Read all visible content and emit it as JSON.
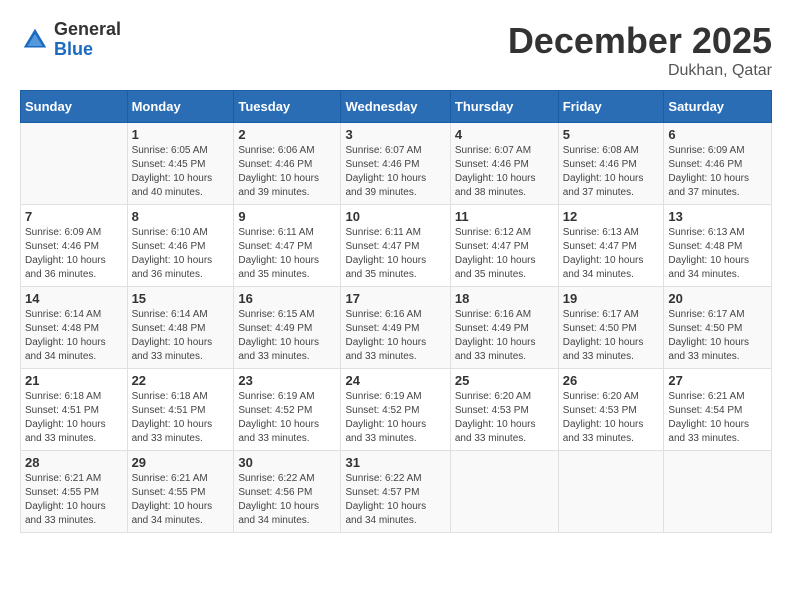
{
  "header": {
    "logo": {
      "general": "General",
      "blue": "Blue"
    },
    "title": "December 2025",
    "location": "Dukhan, Qatar"
  },
  "columns": [
    "Sunday",
    "Monday",
    "Tuesday",
    "Wednesday",
    "Thursday",
    "Friday",
    "Saturday"
  ],
  "weeks": [
    [
      {
        "day": "",
        "info": ""
      },
      {
        "day": "1",
        "info": "Sunrise: 6:05 AM\nSunset: 4:45 PM\nDaylight: 10 hours\nand 40 minutes."
      },
      {
        "day": "2",
        "info": "Sunrise: 6:06 AM\nSunset: 4:46 PM\nDaylight: 10 hours\nand 39 minutes."
      },
      {
        "day": "3",
        "info": "Sunrise: 6:07 AM\nSunset: 4:46 PM\nDaylight: 10 hours\nand 39 minutes."
      },
      {
        "day": "4",
        "info": "Sunrise: 6:07 AM\nSunset: 4:46 PM\nDaylight: 10 hours\nand 38 minutes."
      },
      {
        "day": "5",
        "info": "Sunrise: 6:08 AM\nSunset: 4:46 PM\nDaylight: 10 hours\nand 37 minutes."
      },
      {
        "day": "6",
        "info": "Sunrise: 6:09 AM\nSunset: 4:46 PM\nDaylight: 10 hours\nand 37 minutes."
      }
    ],
    [
      {
        "day": "7",
        "info": "Sunrise: 6:09 AM\nSunset: 4:46 PM\nDaylight: 10 hours\nand 36 minutes."
      },
      {
        "day": "8",
        "info": "Sunrise: 6:10 AM\nSunset: 4:46 PM\nDaylight: 10 hours\nand 36 minutes."
      },
      {
        "day": "9",
        "info": "Sunrise: 6:11 AM\nSunset: 4:47 PM\nDaylight: 10 hours\nand 35 minutes."
      },
      {
        "day": "10",
        "info": "Sunrise: 6:11 AM\nSunset: 4:47 PM\nDaylight: 10 hours\nand 35 minutes."
      },
      {
        "day": "11",
        "info": "Sunrise: 6:12 AM\nSunset: 4:47 PM\nDaylight: 10 hours\nand 35 minutes."
      },
      {
        "day": "12",
        "info": "Sunrise: 6:13 AM\nSunset: 4:47 PM\nDaylight: 10 hours\nand 34 minutes."
      },
      {
        "day": "13",
        "info": "Sunrise: 6:13 AM\nSunset: 4:48 PM\nDaylight: 10 hours\nand 34 minutes."
      }
    ],
    [
      {
        "day": "14",
        "info": "Sunrise: 6:14 AM\nSunset: 4:48 PM\nDaylight: 10 hours\nand 34 minutes."
      },
      {
        "day": "15",
        "info": "Sunrise: 6:14 AM\nSunset: 4:48 PM\nDaylight: 10 hours\nand 33 minutes."
      },
      {
        "day": "16",
        "info": "Sunrise: 6:15 AM\nSunset: 4:49 PM\nDaylight: 10 hours\nand 33 minutes."
      },
      {
        "day": "17",
        "info": "Sunrise: 6:16 AM\nSunset: 4:49 PM\nDaylight: 10 hours\nand 33 minutes."
      },
      {
        "day": "18",
        "info": "Sunrise: 6:16 AM\nSunset: 4:49 PM\nDaylight: 10 hours\nand 33 minutes."
      },
      {
        "day": "19",
        "info": "Sunrise: 6:17 AM\nSunset: 4:50 PM\nDaylight: 10 hours\nand 33 minutes."
      },
      {
        "day": "20",
        "info": "Sunrise: 6:17 AM\nSunset: 4:50 PM\nDaylight: 10 hours\nand 33 minutes."
      }
    ],
    [
      {
        "day": "21",
        "info": "Sunrise: 6:18 AM\nSunset: 4:51 PM\nDaylight: 10 hours\nand 33 minutes."
      },
      {
        "day": "22",
        "info": "Sunrise: 6:18 AM\nSunset: 4:51 PM\nDaylight: 10 hours\nand 33 minutes."
      },
      {
        "day": "23",
        "info": "Sunrise: 6:19 AM\nSunset: 4:52 PM\nDaylight: 10 hours\nand 33 minutes."
      },
      {
        "day": "24",
        "info": "Sunrise: 6:19 AM\nSunset: 4:52 PM\nDaylight: 10 hours\nand 33 minutes."
      },
      {
        "day": "25",
        "info": "Sunrise: 6:20 AM\nSunset: 4:53 PM\nDaylight: 10 hours\nand 33 minutes."
      },
      {
        "day": "26",
        "info": "Sunrise: 6:20 AM\nSunset: 4:53 PM\nDaylight: 10 hours\nand 33 minutes."
      },
      {
        "day": "27",
        "info": "Sunrise: 6:21 AM\nSunset: 4:54 PM\nDaylight: 10 hours\nand 33 minutes."
      }
    ],
    [
      {
        "day": "28",
        "info": "Sunrise: 6:21 AM\nSunset: 4:55 PM\nDaylight: 10 hours\nand 33 minutes."
      },
      {
        "day": "29",
        "info": "Sunrise: 6:21 AM\nSunset: 4:55 PM\nDaylight: 10 hours\nand 34 minutes."
      },
      {
        "day": "30",
        "info": "Sunrise: 6:22 AM\nSunset: 4:56 PM\nDaylight: 10 hours\nand 34 minutes."
      },
      {
        "day": "31",
        "info": "Sunrise: 6:22 AM\nSunset: 4:57 PM\nDaylight: 10 hours\nand 34 minutes."
      },
      {
        "day": "",
        "info": ""
      },
      {
        "day": "",
        "info": ""
      },
      {
        "day": "",
        "info": ""
      }
    ]
  ]
}
